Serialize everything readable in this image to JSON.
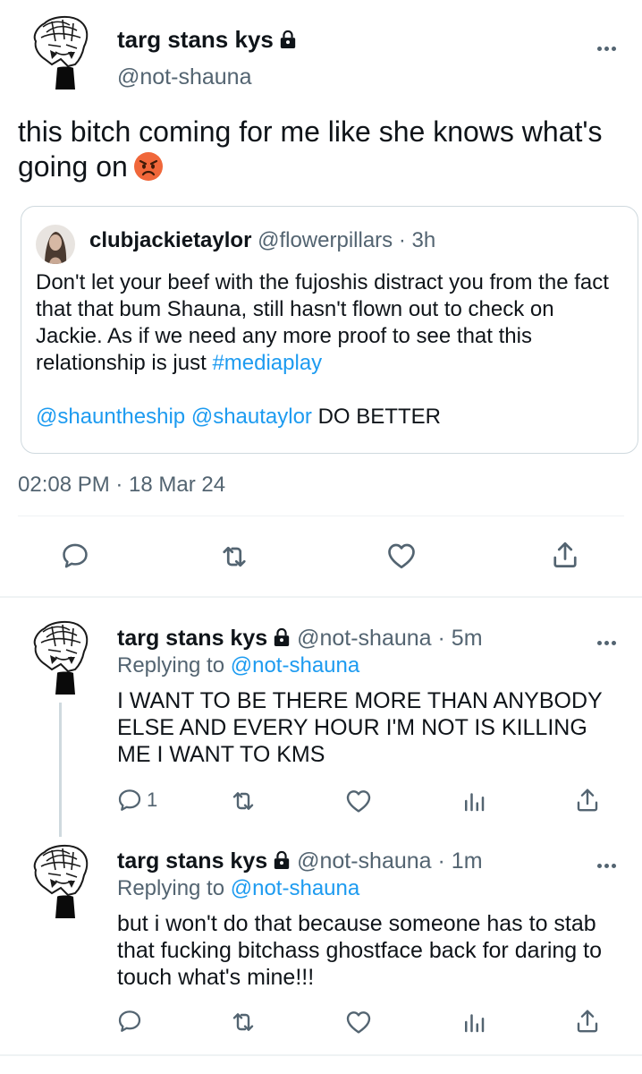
{
  "main_tweet": {
    "display_name": "targ stans kys",
    "handle": "@not-shauna",
    "text": "this bitch coming for me like she knows what's going on",
    "timestamp": "02:08 PM · 18 Mar 24",
    "quoted": {
      "display_name": "clubjackietaylor",
      "handle": "@flowerpillars",
      "time": "· 3h",
      "text": "Don't let your beef with the fujoshis distract you from the fact that that bum Shauna, still hasn't flown out to check on Jackie. As if we need any more proof to see that this relationship is just ",
      "hashtag": "#mediaplay",
      "mention1": "@shauntheship",
      "mention2": "@shautaylor",
      "mentions_tail": "DO BETTER"
    }
  },
  "replies": [
    {
      "display_name": "targ stans kys",
      "handle": "@not-shauna",
      "time": "· 5m",
      "replying_prefix": "Replying to",
      "replying_to": "@not-shauna",
      "text": "I WANT TO BE THERE MORE THAN ANYBODY ELSE AND EVERY HOUR I'M NOT IS KILLING ME I WANT TO KMS",
      "reply_count": "1"
    },
    {
      "display_name": "targ stans kys",
      "handle": "@not-shauna",
      "time": "· 1m",
      "replying_prefix": "Replying to",
      "replying_to": "@not-shauna",
      "text": "but i won't do that because someone has to stab that fucking bitchass ghostface back for daring to touch what's mine!!!",
      "reply_count": ""
    }
  ],
  "icons": {
    "reply": "speech-bubble-icon",
    "retweet": "retweet-icon",
    "like": "heart-icon",
    "share": "share-icon",
    "analytics": "analytics-icon",
    "lock": "lock-icon",
    "more": "more-icon",
    "emoji": "angry-face-emoji"
  },
  "colors": {
    "link": "#1d9bf0",
    "secondary_text": "#536471",
    "divider": "#eff3f4",
    "icon": "#536471"
  }
}
